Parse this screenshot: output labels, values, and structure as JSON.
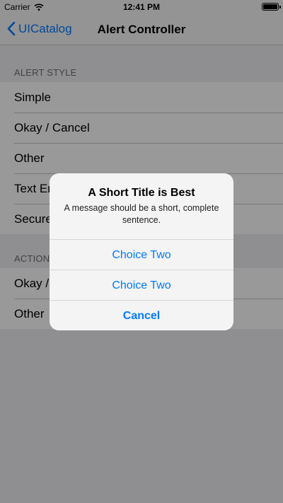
{
  "status_bar": {
    "carrier": "Carrier",
    "time": "12:41 PM",
    "battery_level": 1.0
  },
  "nav": {
    "back_label": "UICatalog",
    "title": "Alert Controller"
  },
  "sections": [
    {
      "header": "ALERT STYLE",
      "items": [
        "Simple",
        "Okay / Cancel",
        "Other",
        "Text Entry",
        "Secure Text Entry"
      ]
    },
    {
      "header": "ACTION SHEET STYLE",
      "items": [
        "Okay / Cancel",
        "Other"
      ]
    }
  ],
  "alert": {
    "title": "A Short Title is Best",
    "message": "A message should be a short, complete sentence.",
    "actions": [
      "Choice Two",
      "Choice Two",
      "Cancel"
    ]
  },
  "colors": {
    "accent": "#007aff",
    "background": "#efeff4",
    "separator": "#c8c7cc"
  }
}
